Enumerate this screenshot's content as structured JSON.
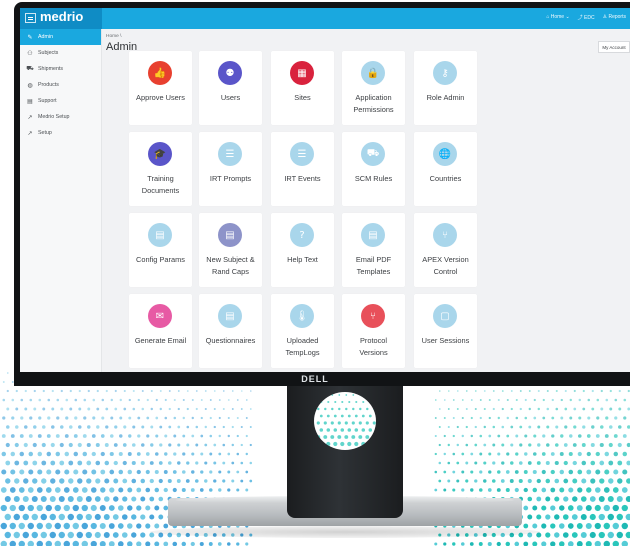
{
  "app": {
    "logo": "medrio",
    "menu_icon": "hamburger-icon"
  },
  "topnav": [
    {
      "label": "⌂ Home ⌄",
      "icon": "home-icon"
    },
    {
      "label": "⤴ EDC",
      "icon": "external-link-icon"
    },
    {
      "label": "♙ Reports",
      "icon": "reports-icon"
    }
  ],
  "sidebar": {
    "items": [
      {
        "label": "Admin",
        "icon": "wrench-icon",
        "glyph": "✎",
        "active": true
      },
      {
        "label": "Subjects",
        "icon": "users-icon",
        "glyph": "⚇",
        "active": false
      },
      {
        "label": "Shipments",
        "icon": "truck-icon",
        "glyph": "⛟",
        "active": false
      },
      {
        "label": "Products",
        "icon": "pill-icon",
        "glyph": "◍",
        "active": false
      },
      {
        "label": "Support",
        "icon": "support-icon",
        "glyph": "▤",
        "active": false
      },
      {
        "label": "Medrio Setup",
        "icon": "tool-icon",
        "glyph": "↗",
        "active": false
      },
      {
        "label": "Setup",
        "icon": "tool-icon",
        "glyph": "↗",
        "active": false
      }
    ]
  },
  "main": {
    "breadcrumb": "Home \\",
    "title": "Admin",
    "account_button": "My Account"
  },
  "tiles": [
    {
      "label": "Approve Users",
      "icon": "thumbs-up-icon",
      "glyph": "👍",
      "color": "#e8402f"
    },
    {
      "label": "Users",
      "icon": "users-icon",
      "glyph": "⚉",
      "color": "#5a55c9"
    },
    {
      "label": "Sites",
      "icon": "building-icon",
      "glyph": "▦",
      "color": "#d9223d"
    },
    {
      "label": "Application Permissions",
      "icon": "lock-icon",
      "glyph": "🔒",
      "color": "#a9d6eb"
    },
    {
      "label": "Role Admin",
      "icon": "key-icon",
      "glyph": "⚷",
      "color": "#a9d6eb"
    },
    {
      "label": "Training Documents",
      "icon": "graduation-cap-icon",
      "glyph": "🎓",
      "color": "#5a55c9"
    },
    {
      "label": "IRT Prompts",
      "icon": "database-icon",
      "glyph": "☰",
      "color": "#a9d6eb"
    },
    {
      "label": "IRT Events",
      "icon": "database-icon",
      "glyph": "☰",
      "color": "#a9d6eb"
    },
    {
      "label": "SCM Rules",
      "icon": "truck-icon",
      "glyph": "⛟",
      "color": "#a9d6eb"
    },
    {
      "label": "Countries",
      "icon": "globe-icon",
      "glyph": "🌐",
      "color": "#a9d6eb"
    },
    {
      "label": "Config Params",
      "icon": "server-icon",
      "glyph": "▤",
      "color": "#a9d6eb"
    },
    {
      "label": "New Subject & Rand Caps",
      "icon": "server-icon",
      "glyph": "▤",
      "color": "#8d93c9"
    },
    {
      "label": "Help Text",
      "icon": "question-icon",
      "glyph": "?",
      "color": "#a9d6eb"
    },
    {
      "label": "Email PDF Templates",
      "icon": "file-icon",
      "glyph": "▤",
      "color": "#a9d6eb"
    },
    {
      "label": "APEX Version Control",
      "icon": "branch-icon",
      "glyph": "⑂",
      "color": "#a9d6eb"
    },
    {
      "label": "Generate Email",
      "icon": "envelope-icon",
      "glyph": "✉",
      "color": "#e75aa4"
    },
    {
      "label": "Questionnaires",
      "icon": "document-icon",
      "glyph": "▤",
      "color": "#a9d6eb"
    },
    {
      "label": "Uploaded TempLogs",
      "icon": "thermometer-icon",
      "glyph": "🌡",
      "color": "#a9d6eb"
    },
    {
      "label": "Protocol Versions",
      "icon": "branch-icon",
      "glyph": "⑂",
      "color": "#e8505a"
    },
    {
      "label": "User Sessions",
      "icon": "screen-icon",
      "glyph": "▢",
      "color": "#a9d6eb"
    }
  ],
  "monitor": {
    "brand": "DELL"
  }
}
